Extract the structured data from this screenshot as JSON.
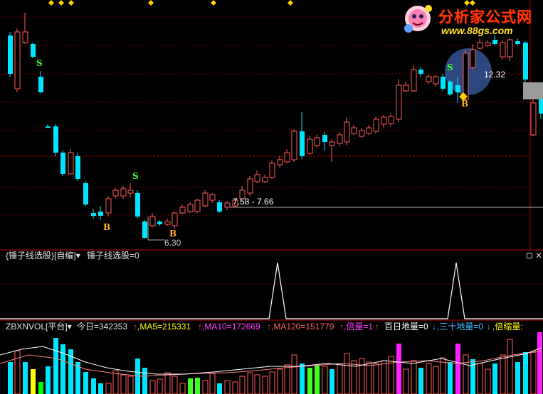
{
  "main_chart": {
    "price_label_high": "12.32",
    "price_label_range": "7.58 - 7.66",
    "price_label_low": "6.30",
    "signal_buy": "B",
    "signal_sell": "S"
  },
  "indicator_panel": {
    "name": "锤子线选股",
    "source": "自编",
    "value_text": "锤子线选股=0"
  },
  "volume_panel": {
    "name": "ZBXNVOL",
    "source": "平台",
    "today": "今日=342353",
    "ma5": ",MA5=215331",
    "ma10": ",MA10=172669",
    "ma120": ",MA120=151779",
    "ratio": ",倍量=1",
    "hundred_day_low": "百日地量=0",
    "thirty_day_low": ",三十地量=0",
    "shrink": ",倍缩量:"
  },
  "watermark": {
    "title": "分析家公式网",
    "url": "www.88gs.com"
  },
  "colors": {
    "up": "#ff5a5a",
    "down": "#00e5ff",
    "ma5": "#ffff00",
    "ma10": "#ff40ff",
    "ma120": "#ff6060",
    "ratio": "#ff40ff",
    "signal_line": "#ffffff",
    "grid": "#7a0000"
  }
}
